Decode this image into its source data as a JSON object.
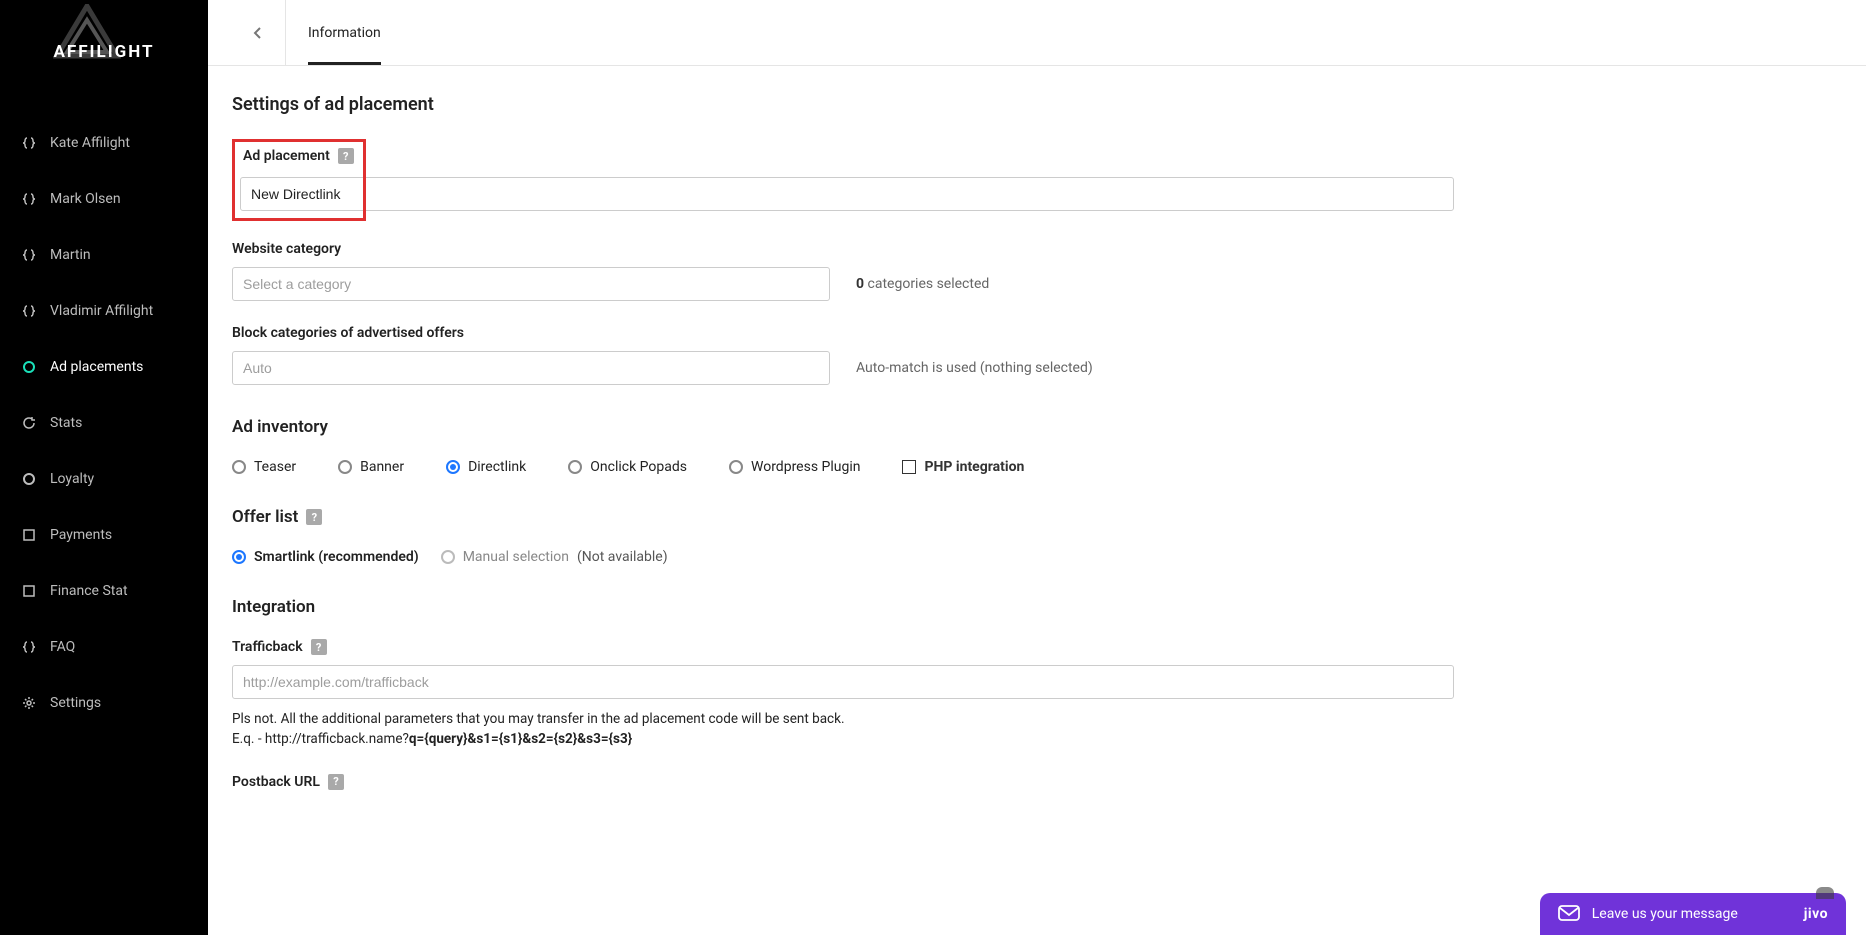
{
  "brand": "AFFILIGHT",
  "sidebar": {
    "items": [
      {
        "label": "Kate Affilight",
        "icon": "braces"
      },
      {
        "label": "Mark Olsen",
        "icon": "braces"
      },
      {
        "label": "Martin",
        "icon": "braces"
      },
      {
        "label": "Vladimir Affilight",
        "icon": "braces"
      },
      {
        "label": "Ad placements",
        "icon": "circle",
        "active": true
      },
      {
        "label": "Stats",
        "icon": "refresh"
      },
      {
        "label": "Loyalty",
        "icon": "circle"
      },
      {
        "label": "Payments",
        "icon": "square"
      },
      {
        "label": "Finance Stat",
        "icon": "square"
      },
      {
        "label": "FAQ",
        "icon": "braces"
      },
      {
        "label": "Settings",
        "icon": "gear"
      }
    ]
  },
  "tabs": [
    {
      "label": "Information",
      "active": true
    }
  ],
  "headings": {
    "settings": "Settings of ad placement",
    "ad_inventory": "Ad inventory",
    "offer_list": "Offer list",
    "integration": "Integration"
  },
  "fields": {
    "ad_placement": {
      "label": "Ad placement",
      "value": "New Directlink"
    },
    "website_category": {
      "label": "Website category",
      "placeholder": "Select a category",
      "hint_count": "0",
      "hint_text": " categories selected"
    },
    "block_categories": {
      "label": "Block categories of advertised offers",
      "placeholder": "Auto",
      "hint": "Auto-match is used (nothing selected)"
    },
    "trafficback": {
      "label": "Trafficback",
      "placeholder": "http://example.com/trafficback",
      "note1": "Pls not. All the additional parameters that you may transfer in the ad placement code will be sent back.",
      "note2_pre": "E.q. - http://trafficback.name?",
      "note2_bold": "q={query}&s1={s1}&s2={s2}&s3={s3}"
    },
    "postback": {
      "label": "Postback URL"
    }
  },
  "ad_inventory": {
    "options": [
      {
        "label": "Teaser",
        "type": "radio",
        "checked": false
      },
      {
        "label": "Banner",
        "type": "radio",
        "checked": false
      },
      {
        "label": "Directlink",
        "type": "radio",
        "checked": true
      },
      {
        "label": "Onclick Popads",
        "type": "radio",
        "checked": false
      },
      {
        "label": "Wordpress Plugin",
        "type": "radio",
        "checked": false
      },
      {
        "label": "PHP integration",
        "type": "checkbox",
        "checked": false
      }
    ]
  },
  "offer_list": {
    "options": [
      {
        "label": "Smartlink (recommended)",
        "checked": true,
        "disabled": false
      },
      {
        "label": "Manual selection",
        "checked": false,
        "disabled": true
      }
    ],
    "na": "(Not available)"
  },
  "jivo": {
    "text": "Leave us your message",
    "brand": "jivo"
  }
}
